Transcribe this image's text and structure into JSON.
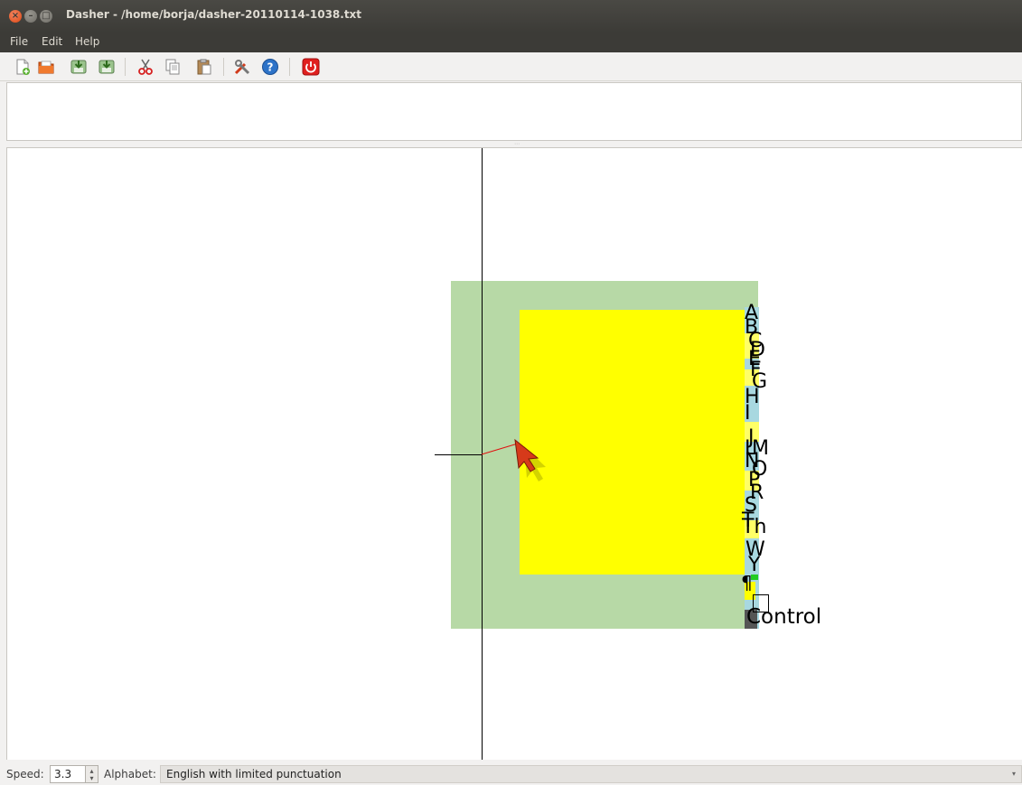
{
  "window": {
    "title": "Dasher - /home/borja/dasher-20110114-1038.txt",
    "close_glyph": "×",
    "min_glyph": "–",
    "max_glyph": "□"
  },
  "menu": {
    "items": [
      {
        "label": "File"
      },
      {
        "label": "Edit"
      },
      {
        "label": "Help"
      }
    ]
  },
  "toolbar": {
    "buttons": [
      {
        "name": "new-document-icon"
      },
      {
        "name": "open-folder-icon"
      },
      {
        "name": "save-icon"
      },
      {
        "name": "save-as-icon"
      },
      {
        "name": "cut-icon"
      },
      {
        "name": "copy-icon"
      },
      {
        "name": "paste-icon"
      },
      {
        "name": "preferences-icon"
      },
      {
        "name": "help-icon"
      },
      {
        "name": "quit-icon"
      }
    ]
  },
  "text_area": {
    "value": ""
  },
  "canvas": {
    "colors": {
      "outer_box": "#b7d9a6",
      "inner_box": "#ffff00",
      "crosshair": "#000000",
      "pointer_line": "#e01010"
    },
    "letters": [
      "A",
      "B",
      "C",
      "D",
      "E",
      "F",
      "G",
      "H",
      "I",
      "J",
      "L",
      "M",
      "N",
      "O",
      "P",
      "R",
      "S",
      "T",
      "Th",
      "W",
      "Y",
      "¶",
      "Control"
    ]
  },
  "status": {
    "speed_label": "Speed:",
    "speed_value": "3.3",
    "alphabet_label": "Alphabet:",
    "alphabet_value": "English with limited punctuation"
  }
}
